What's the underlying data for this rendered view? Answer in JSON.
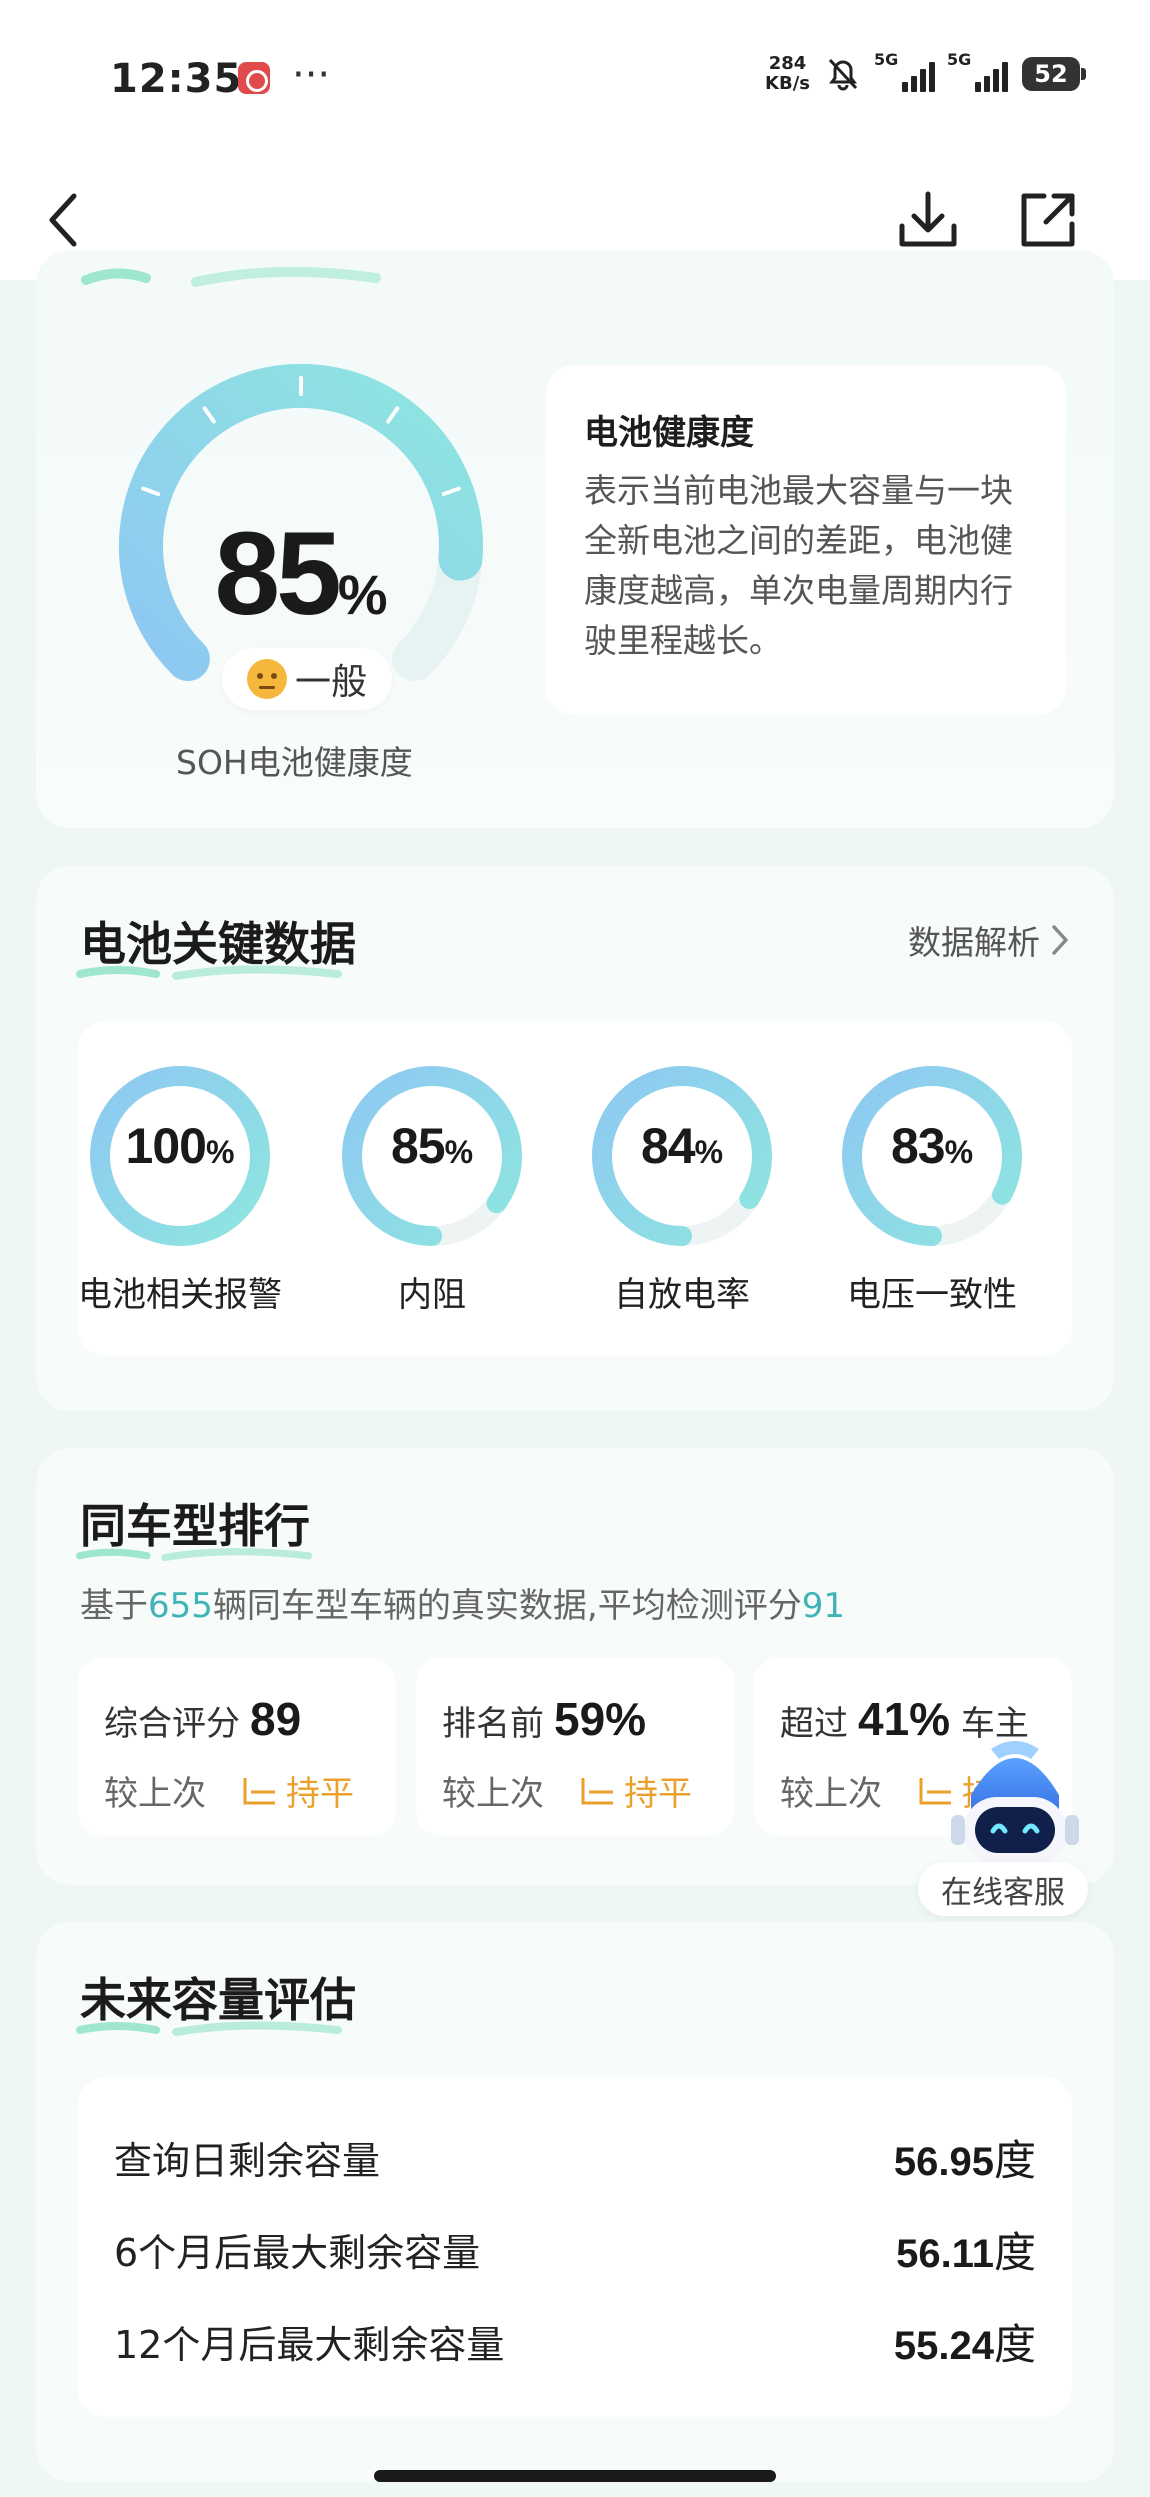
{
  "status_bar": {
    "time": "12:35",
    "dots": "···",
    "net_speed_value": "284",
    "net_speed_unit": "KB/s",
    "sim1": "5G",
    "sim2": "5G",
    "battery": "52"
  },
  "nav": {
    "back_icon": "chevron-left-icon",
    "download_icon": "download-icon",
    "share_icon": "external-link-icon"
  },
  "health": {
    "value": "85",
    "unit": "%",
    "percent": 85,
    "badge": "一般",
    "label": "SOH电池健康度",
    "info_title": "电池健康度",
    "info_text": "表示当前电池最大容量与一块全新电池之间的差距，电池健康度越高，单次电量周期内行驶里程越长。"
  },
  "key_data": {
    "title": "电池关键数据",
    "link": "数据解析",
    "items": [
      {
        "value": "100",
        "unit": "%",
        "percent": 100,
        "label": "电池相关报警"
      },
      {
        "value": "85",
        "unit": "%",
        "percent": 85,
        "label": "内阻"
      },
      {
        "value": "84",
        "unit": "%",
        "percent": 84,
        "label": "自放电率"
      },
      {
        "value": "83",
        "unit": "%",
        "percent": 83,
        "label": "电压一致性"
      }
    ]
  },
  "ranking": {
    "title": "同车型排行",
    "subtitle_prefix": "基于",
    "subtitle_count": "655",
    "subtitle_mid": "辆同车型车辆的真实数据,平均检测评分",
    "subtitle_score": "91",
    "stats": [
      {
        "label": "综合评分",
        "value": "89",
        "compare": "较上次",
        "trend": "持平"
      },
      {
        "label": "排名前",
        "value": "59%",
        "compare": "较上次",
        "trend": "持平"
      },
      {
        "label": "超过",
        "value": "41%",
        "suffix": "车主",
        "compare": "较上次",
        "trend": "持平"
      }
    ]
  },
  "service": {
    "label": "在线客服"
  },
  "capacity": {
    "title": "未来容量评估",
    "rows": [
      {
        "label": "查询日剩余容量",
        "value": "56.95",
        "unit": "度"
      },
      {
        "label": "6个月后最大剩余容量",
        "value": "56.11",
        "unit": "度"
      },
      {
        "label": "12个月后最大剩余容量",
        "value": "55.24",
        "unit": "度"
      }
    ]
  },
  "colors": {
    "accent_teal": "#7fe0d6",
    "accent_blue": "#8ec8f2",
    "highlight": "#3fb3b6",
    "trend_flat": "#e9a12c"
  }
}
